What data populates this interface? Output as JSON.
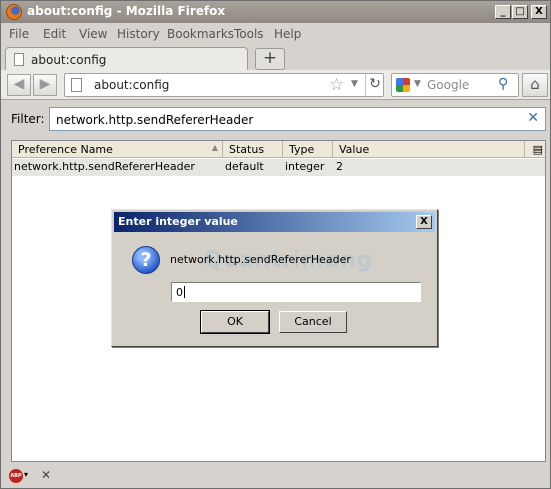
{
  "window": {
    "title": "about:config - Mozilla Firefox",
    "min": "_",
    "max": "□",
    "close": "X"
  },
  "menu": [
    "File",
    "Edit",
    "View",
    "History",
    "Bookmarks",
    "Tools",
    "Help"
  ],
  "tab": {
    "label": "about:config",
    "new_tab": "+"
  },
  "nav": {
    "url": "about:config",
    "search_placeholder": "Google"
  },
  "filter": {
    "label": "Filter:",
    "value": "network.http.sendRefererHeader"
  },
  "table": {
    "headers": [
      "Preference Name",
      "Status",
      "Type",
      "Value"
    ],
    "rows": [
      {
        "name": "network.http.sendRefererHeader",
        "status": "default",
        "type": "integer",
        "value": "2"
      }
    ]
  },
  "dialog": {
    "title": "Enter integer value",
    "message": "network.http.sendRefererHeader",
    "input_value": "0",
    "ok": "OK",
    "cancel": "Cancel",
    "watermark": "Quantrimang"
  },
  "statusbar": {
    "abp": "ABP"
  }
}
